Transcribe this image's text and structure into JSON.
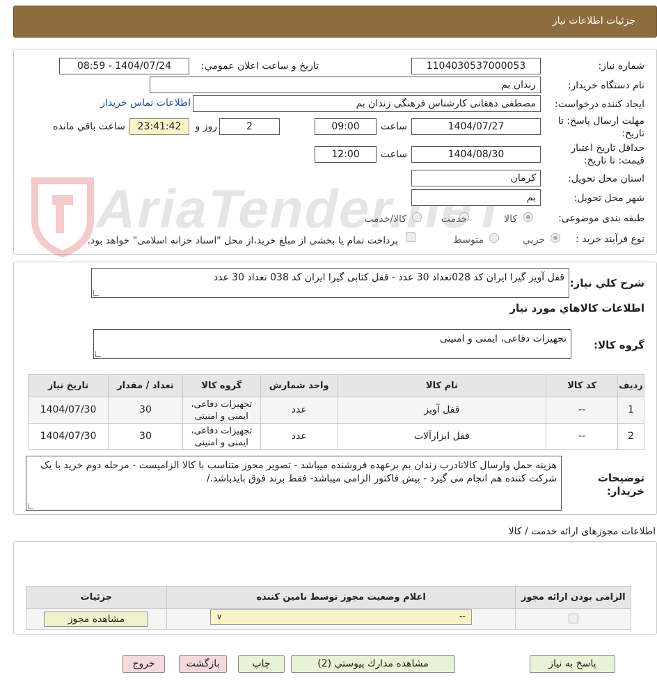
{
  "header": {
    "title": "جزئیات اطلاعات نیاز"
  },
  "fields": {
    "need_number_label": "شماره نیاز:",
    "need_number": "1104030537000053",
    "announce_label": "تاریخ و ساعت اعلان عمومي:",
    "announce_value": "1404/07/24 - 08:59",
    "buyer_org_label": "نام دستگاه خريدار:",
    "buyer_org": "زندان بم",
    "creator_label": "ايجاد کننده درخواست:",
    "creator": "مصطفی دهقانی کارشناس فرهنگی زندان بم",
    "contact_link": "اطلاعات تماس خريدار",
    "reply_deadline_label_1": "مهلت ارسال پاسخ: تا",
    "reply_deadline_label_2": "تاريخ:",
    "reply_date": "1404/07/27",
    "time_label": "ساعت",
    "reply_time": "09:00",
    "days_value": "2",
    "days_label": "روز و",
    "remaining_time": "23:41:42",
    "remaining_label": "ساعت باقي مانده",
    "validity_label_1": "حداقل تاريخ اعتبار",
    "validity_label_2": "قيمت: تا تاريخ:",
    "validity_date": "1404/08/30",
    "validity_time_label": "ساعت",
    "validity_time": "12:00",
    "province_label": "استان محل تحويل:",
    "province": "کرمان",
    "city_label": "شهر محل تحويل:",
    "city": "بم",
    "category_label": "طبقه بندی موضوعی:",
    "category_options": [
      "کالا",
      "خدمت",
      "کالا/خدمت"
    ],
    "process_label": "نوع فرآيند خريد :",
    "process_options": [
      "جزيي",
      "متوسط"
    ],
    "treasury_note": "پرداخت تمام يا بخشی از مبلغ خريد،از محل \"اسناد خزانه اسلامی\" خواهد بود."
  },
  "description": {
    "label": "شرح کلي نياز:",
    "text": "قفل آویز گیرا ایران کد 028تعداد 30 عدد - قفل کتابی گیرا ایران کد 038 تعداد 30 عدد"
  },
  "goods": {
    "section_title": "اطلاعات کالاهاي مورد نياز",
    "group_label": "گروه کالا:",
    "group_value": "تجهیزات دفاعی، ایمنی و امنیتی",
    "columns": [
      "رديف",
      "کد کالا",
      "نام کالا",
      "واحد شمارش",
      "گروه کالا",
      "تعداد / مقدار",
      "تاريخ نياز"
    ],
    "rows": [
      [
        "1",
        "--",
        "قفل آویز",
        "عدد",
        "تجهیزات دفاعی، ایمنی و امنیتی",
        "30",
        "1404/07/30"
      ],
      [
        "2",
        "--",
        "قفل ابزارآلات",
        "عدد",
        "تجهیزات دفاعی، ایمنی و امنیتی",
        "30",
        "1404/07/30"
      ]
    ]
  },
  "buyer_notes": {
    "label_1": "توضيحات",
    "label_2": "خريدار:",
    "text": "هزینه حمل وارسال کالاتادرب زندان بم برعهده فروشنده میباشد - تصویر مجوز متناسب با کالا الزامیست  - مرحله دوم خرید با یک شرکت کننده هم انجام می گیرد - پیش فاکتور الزامی میباشد- فقط برند فوق بایدباشد./"
  },
  "permits": {
    "section_title": "اطلاعات مجوزهای ارائه خدمت / کالا",
    "columns": [
      "الزامی بودن ارائه مجوز",
      "اعلام وضعيت مجوز توسط نامين کننده",
      "جزئيات"
    ],
    "select_value": "--",
    "view_button": "مشاهده مجوز"
  },
  "buttons": {
    "reply": "پاسخ به نياز",
    "attachments": "مشاهده مدارك پيوستي (2)",
    "print": "چاپ",
    "back": "بازگشت",
    "exit": "خروج"
  },
  "watermark": {
    "text": "AriaTender.neT"
  },
  "colors": {
    "header_bg": "#8e6c3e",
    "remaining_bg": "#f9f3c7",
    "link": "#1a4fa0"
  }
}
